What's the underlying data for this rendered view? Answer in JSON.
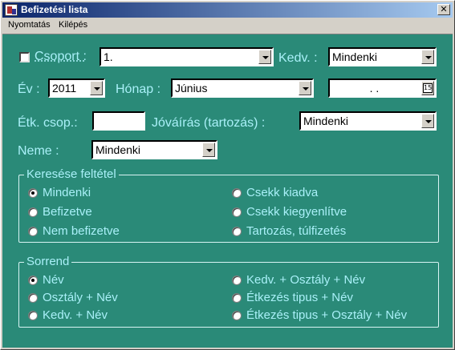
{
  "window": {
    "title": "Befizetési lista",
    "close_glyph": "✕"
  },
  "menu": {
    "items": [
      "Nyomtatás",
      "Kilépés"
    ]
  },
  "form": {
    "csoport": {
      "label": "Csoport :",
      "checked": false,
      "value": "1."
    },
    "kedv": {
      "label": "Kedv. :",
      "value": "Mindenki"
    },
    "ev": {
      "label": "Év :",
      "value": "2011"
    },
    "honap": {
      "label": "Hónap :",
      "value": "Június"
    },
    "date": {
      "value": ". .",
      "calendar_glyph": "15"
    },
    "etk_csop": {
      "label": "Étk. csop.:",
      "value": ""
    },
    "jovairas": {
      "label": "Jóváírás (tartozás) :",
      "value": "Mindenki"
    },
    "neme": {
      "label": "Neme :",
      "value": "Mindenki"
    }
  },
  "kereses": {
    "title": "Keresése feltétel",
    "options": [
      "Mindenki",
      "Befizetve",
      "Nem befizetve",
      "Csekk kiadva",
      "Csekk kiegyenlítve",
      "Tartozás, túlfizetés"
    ],
    "selected": "Mindenki"
  },
  "sorrend": {
    "title": "Sorrend",
    "options": [
      "Név",
      "Osztály + Név",
      "Kedv. + Név",
      "Kedv. + Osztály + Név",
      "Étkezés tipus + Név",
      "Étkezés tipus + Osztály + Név"
    ],
    "selected": "Név"
  },
  "colors": {
    "title_bar_start": "#0a246a",
    "title_bar_end": "#a6caf0",
    "client_background": "#2a8a78",
    "label_text": "#a9f0f8"
  }
}
